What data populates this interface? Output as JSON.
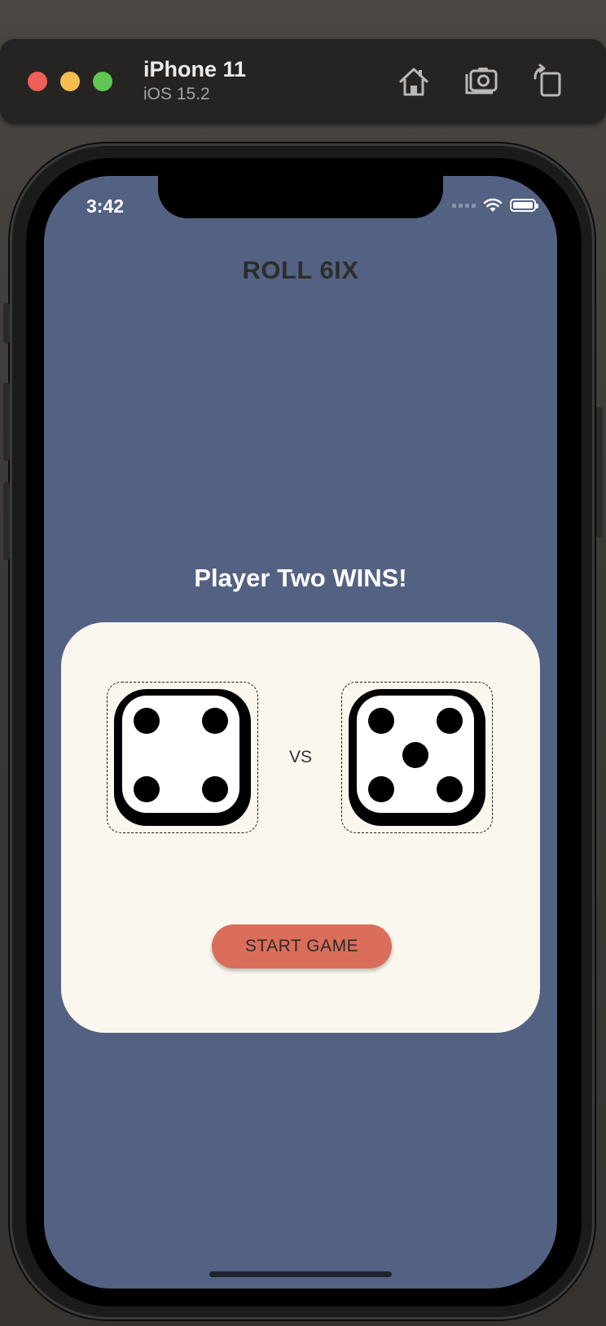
{
  "simulator": {
    "device_name": "iPhone 11",
    "os_version": "iOS 15.2",
    "toolbar_icons": [
      "home-icon",
      "screenshot-icon",
      "rotate-icon"
    ]
  },
  "status_bar": {
    "time": "3:42",
    "icons": [
      "cellular-icon",
      "wifi-icon",
      "battery-icon"
    ]
  },
  "app": {
    "title": "ROLL 6IX",
    "result": "Player Two WINS!",
    "vs_label": "VS",
    "start_button": "START GAME",
    "dice": [
      {
        "player": "one",
        "value": 4
      },
      {
        "player": "two",
        "value": 5
      }
    ],
    "colors": {
      "background": "#536282",
      "card": "#fbf7ee",
      "button": "#db6e5a"
    }
  }
}
